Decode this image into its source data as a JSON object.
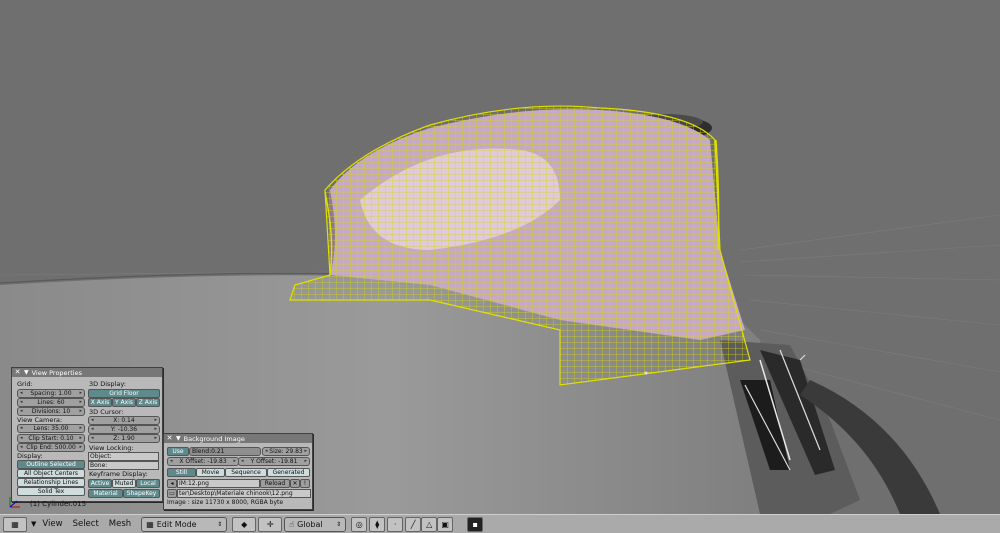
{
  "view_properties": {
    "title": "View Properties",
    "grid_label": "Grid:",
    "spacing": "Spacing: 1.00",
    "lines": "Lines: 60",
    "divisions": "Divisions: 10",
    "view_camera_label": "View Camera:",
    "lens": "Lens: 35.00",
    "clip_start": "Clip Start: 0.10",
    "clip_end": "Clip End: 500.00",
    "display_label": "Display:",
    "outline_selected": "Outline Selected",
    "all_object_centers": "All Object Centers",
    "relationship_lines": "Relationship Lines",
    "solid_tex": "Solid Tex",
    "display_3d_label": "3D Display:",
    "grid_floor": "Grid Floor",
    "x_axis": "X Axis",
    "y_axis": "Y Axis",
    "z_axis": "Z Axis",
    "cursor_label": "3D Cursor:",
    "cursor_x": "X: 0.14",
    "cursor_y": "Y: -10.36",
    "cursor_z": "Z: 1.90",
    "view_locking_label": "View Locking:",
    "object_field": "Object:",
    "bone_field": "Bone:",
    "keyframe_display_label": "Keyframe Display:",
    "active": "Active",
    "muted": "Muted",
    "local": "Local",
    "material": "Material",
    "shapekey": "ShapeKey"
  },
  "background_image": {
    "title": "Background Image",
    "use": "Use",
    "blend": "Blend:0.21",
    "size": "Size: 29.83",
    "x_offset": "X Offset: -19.83",
    "y_offset": "Y Offset: -19.81",
    "still": "Still",
    "movie": "Movie",
    "sequence": "Sequence",
    "generated": "Generated",
    "image_name": "IM:12.png",
    "reload": "Reload",
    "filepath": "ter\\Desktop\\Materiale chinook\\12.png",
    "info": "Image : size 11730 x 8000, RGBA byte"
  },
  "status": {
    "object_label": "(1) Cylinder.015"
  },
  "header": {
    "view": "View",
    "select": "Select",
    "mesh": "Mesh",
    "mode": "Edit Mode",
    "orientation": "Global"
  }
}
